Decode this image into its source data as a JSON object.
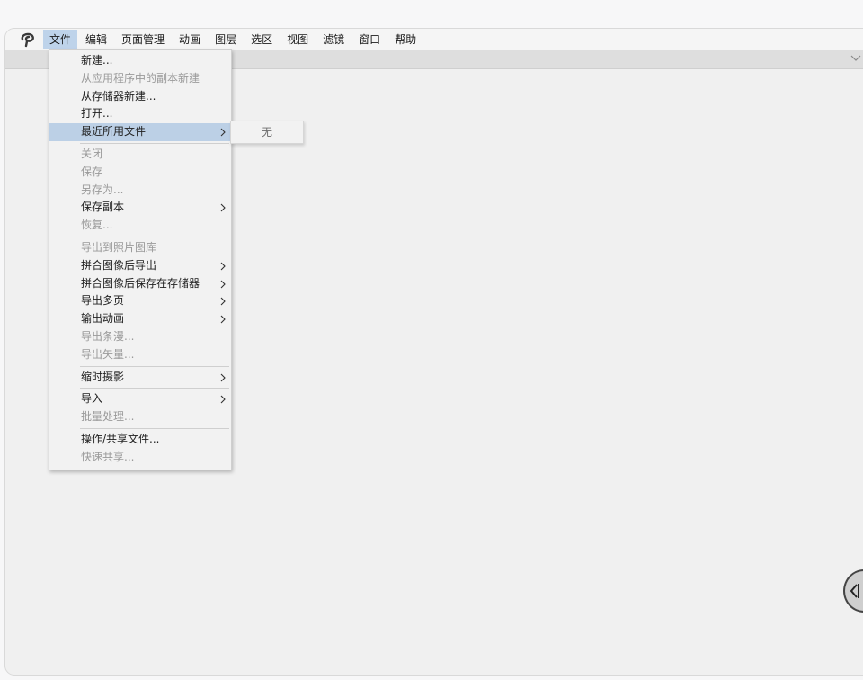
{
  "app": {
    "logo_icon": "clip-studio-logo-icon"
  },
  "menubar": {
    "items": [
      {
        "label": "文件"
      },
      {
        "label": "编辑"
      },
      {
        "label": "页面管理"
      },
      {
        "label": "动画"
      },
      {
        "label": "图层"
      },
      {
        "label": "选区"
      },
      {
        "label": "视图"
      },
      {
        "label": "滤镜"
      },
      {
        "label": "窗口"
      },
      {
        "label": "帮助"
      }
    ],
    "active_index": 0
  },
  "file_menu": {
    "items": [
      {
        "label": "新建...",
        "disabled": false
      },
      {
        "label": "从应用程序中的副本新建",
        "disabled": true
      },
      {
        "label": "从存储器新建...",
        "disabled": false
      },
      {
        "label": "打开...",
        "disabled": false
      },
      {
        "label": "最近所用文件",
        "disabled": false,
        "submenu": true,
        "highlighted": true
      },
      {
        "label": "关闭",
        "disabled": true
      },
      {
        "label": "保存",
        "disabled": true
      },
      {
        "label": "另存为...",
        "disabled": true
      },
      {
        "label": "保存副本",
        "disabled": false,
        "submenu": true
      },
      {
        "label": "恢复...",
        "disabled": true
      },
      {
        "label": "导出到照片图库",
        "disabled": true
      },
      {
        "label": "拼合图像后导出",
        "disabled": false,
        "submenu": true
      },
      {
        "label": "拼合图像后保存在存储器",
        "disabled": false,
        "submenu": true
      },
      {
        "label": "导出多页",
        "disabled": false,
        "submenu": true
      },
      {
        "label": "输出动画",
        "disabled": false,
        "submenu": true
      },
      {
        "label": "导出条漫...",
        "disabled": true
      },
      {
        "label": "导出矢量...",
        "disabled": true
      },
      {
        "label": "缩时摄影",
        "disabled": false,
        "submenu": true
      },
      {
        "label": "导入",
        "disabled": false,
        "submenu": true
      },
      {
        "label": "批量处理...",
        "disabled": true
      },
      {
        "label": "操作/共享文件...",
        "disabled": false
      },
      {
        "label": "快速共享...",
        "disabled": true
      }
    ]
  },
  "recent_submenu": {
    "empty_label": "无"
  },
  "colors": {
    "menu_highlight": "#bcd0e6",
    "disabled_text": "#9a9a9a"
  }
}
